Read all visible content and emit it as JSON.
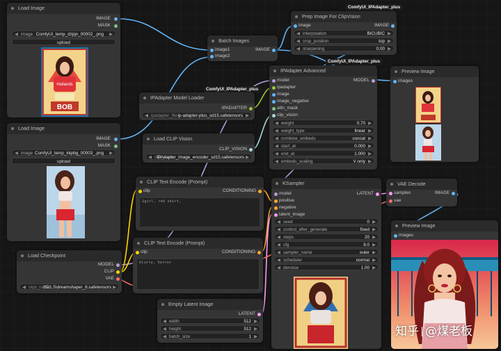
{
  "colors": {
    "image": "#64b5f6",
    "mask": "#81c784",
    "model": "#b39ddb",
    "clip": "#ffd500",
    "conditioning": "#ffa931",
    "latent": "#ff9cf9",
    "vae": "#ff6e6e",
    "ipadapter": "#9bc53d",
    "clip_vision": "#a8dadc",
    "wire_image": "#64b5f6",
    "wire_model": "#b39ddb"
  },
  "load_image_1": {
    "title": "Load Image",
    "out_image": "IMAGE",
    "out_mask": "MASK",
    "widget_label": "image",
    "widget_value": "ComfyUI_temp_dzjqn_00002_.png",
    "upload": "upload"
  },
  "load_image_2": {
    "title": "Load Image",
    "out_image": "IMAGE",
    "out_mask": "MASK",
    "widget_label": "image",
    "widget_value": "ComfyUI_temp_kkpbg_00003_.png",
    "upload": "upload"
  },
  "batch_images": {
    "title": "Batch Images",
    "in1": "image1",
    "in2": "image2",
    "out": "IMAGE"
  },
  "prep_image": {
    "title": "Prep Image For ClipVision",
    "in_image": "image",
    "out_image": "IMAGE",
    "interpolation_label": "interpolation",
    "interpolation_value": "BICUBIC",
    "crop_label": "crop_position",
    "crop_value": "top",
    "sharpening_label": "sharpening",
    "sharpening_value": "0.00"
  },
  "tags": {
    "tag1": "ComfyUI_IPAdapter_plus",
    "tag2": "ComfyUI_IPAdapter_plus",
    "tag3": "ComfyUI_IPAdapter_plus"
  },
  "ipadapter_loader": {
    "title": "IPAdapter Model Loader",
    "out": "IPADAPTER",
    "widget_label": "ipadapter_file",
    "widget_value": "ip-adapter-plus_sd15.safetensors"
  },
  "ipadapter_adv": {
    "title": "IPAdapter Advanced",
    "inputs": [
      "model",
      "ipadapter",
      "image",
      "image_negative",
      "attn_mask",
      "clip_vision"
    ],
    "out": "MODEL",
    "widgets": [
      {
        "label": "weight",
        "value": "0.70"
      },
      {
        "label": "weight_type",
        "value": "linear"
      },
      {
        "label": "combine_embeds",
        "value": "concat"
      },
      {
        "label": "start_at",
        "value": "0.000"
      },
      {
        "label": "end_at",
        "value": "1.000"
      },
      {
        "label": "embeds_scaling",
        "value": "V only"
      }
    ]
  },
  "preview_1": {
    "title": "Preview Image",
    "in": "images"
  },
  "preview_2": {
    "title": "Preview Image",
    "in": "images"
  },
  "clip_vision": {
    "title": "Load CLIP Vision",
    "out": "CLIP_VISION",
    "widget_label": "clip_name",
    "widget_value": "IPAdapter_image_encoder_sd15.safetensors"
  },
  "clip_pos": {
    "title": "CLIP Text Encode (Prompt)",
    "in": "clip",
    "out": "CONDITIONING",
    "text": "1girl, red skirt,"
  },
  "clip_neg": {
    "title": "CLIP Text Encode (Prompt)",
    "in": "clip",
    "out": "CONDITIONING",
    "text": "blurry, horror"
  },
  "ksampler": {
    "title": "KSampler",
    "inputs": [
      "model",
      "positive",
      "negative",
      "latent_image"
    ],
    "out": "LATENT",
    "widgets": [
      {
        "label": "seed",
        "value": "0"
      },
      {
        "label": "control_after_generate",
        "value": "fixed"
      },
      {
        "label": "steps",
        "value": "20"
      },
      {
        "label": "cfg",
        "value": "8.0"
      },
      {
        "label": "sampler_name",
        "value": "euler"
      },
      {
        "label": "scheduler",
        "value": "normal"
      },
      {
        "label": "denoise",
        "value": "1.00"
      }
    ]
  },
  "vae_decode": {
    "title": "VAE Decode",
    "in_samples": "samples",
    "in_vae": "vae",
    "out": "IMAGE"
  },
  "checkpoint": {
    "title": "Load Checkpoint",
    "out_model": "MODEL",
    "out_clip": "CLIP",
    "out_vae": "VAE",
    "widget_label": "ckpt_name",
    "widget_value": "SD1.5\\dreamshaper_8.safetensors"
  },
  "empty_latent": {
    "title": "Empty Latent Image",
    "out": "LATENT",
    "widgets": [
      {
        "label": "width",
        "value": "512"
      },
      {
        "label": "height",
        "value": "512"
      },
      {
        "label": "batch_size",
        "value": "1"
      }
    ]
  },
  "watermark": {
    "left": "知乎",
    "right": "@煤老板"
  }
}
